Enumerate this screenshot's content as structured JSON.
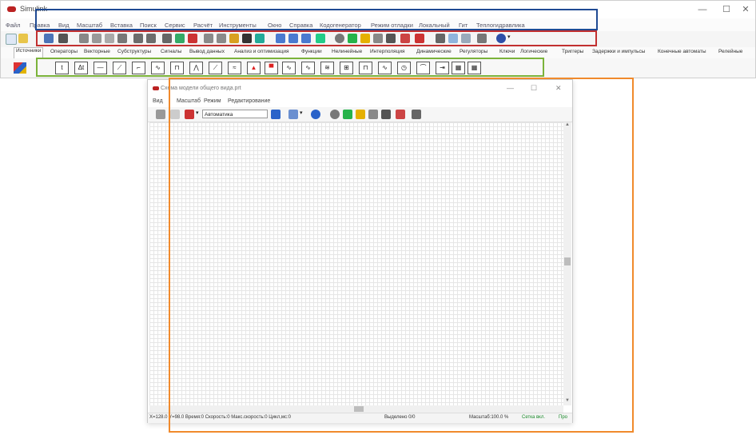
{
  "main_window": {
    "title": "Simulink",
    "window_controls": {
      "minimize": "—",
      "maximize": "☐",
      "close": "✕"
    },
    "menu": [
      "Файл",
      "Правка",
      "Вид",
      "Масштаб",
      "Вставка",
      "Поиск",
      "Сервис",
      "Расчёт",
      "Инструменты",
      "Окно",
      "Справка",
      "Кодогенератор",
      "Режим отладки",
      "Локальный",
      "Гит",
      "Теплогидравлика"
    ],
    "tabs": [
      "Источники",
      "Операторы",
      "Векторные",
      "Субструктуры",
      "Сигналы",
      "Вывод данных",
      "Анализ и оптимизация",
      "Функции",
      "Нелинейные",
      "Интерполяция",
      "Динамические",
      "Регуляторы",
      "Ключи",
      "Логические",
      "Триггеры",
      "Задержки и импульсы",
      "Конечные автоматы",
      "Релейные"
    ],
    "block_palette": [
      "t",
      "Δt"
    ]
  },
  "child_window": {
    "title": "Схема модели общего вида.prt",
    "window_controls": {
      "minimize": "—",
      "maximize": "☐",
      "close": "✕"
    },
    "menu": [
      "Вид",
      "Масштаб",
      "Режим",
      "Редактирование"
    ],
    "mode_select": "Автоматика",
    "status": {
      "coords": "X=128.0 Y=98.0 Время:0 Скорость:0 Макс.скорость:0 Цикл,мс:0",
      "selected": "Выделено 0/0",
      "zoom": "Масштаб:100.0 %",
      "grid": "Сетка вкл.",
      "extra": "Про"
    }
  },
  "colors": {
    "highlight_blue": "#1f4a93",
    "highlight_red": "#c23030",
    "highlight_green": "#7bb33a",
    "highlight_orange": "#f08a2c"
  }
}
